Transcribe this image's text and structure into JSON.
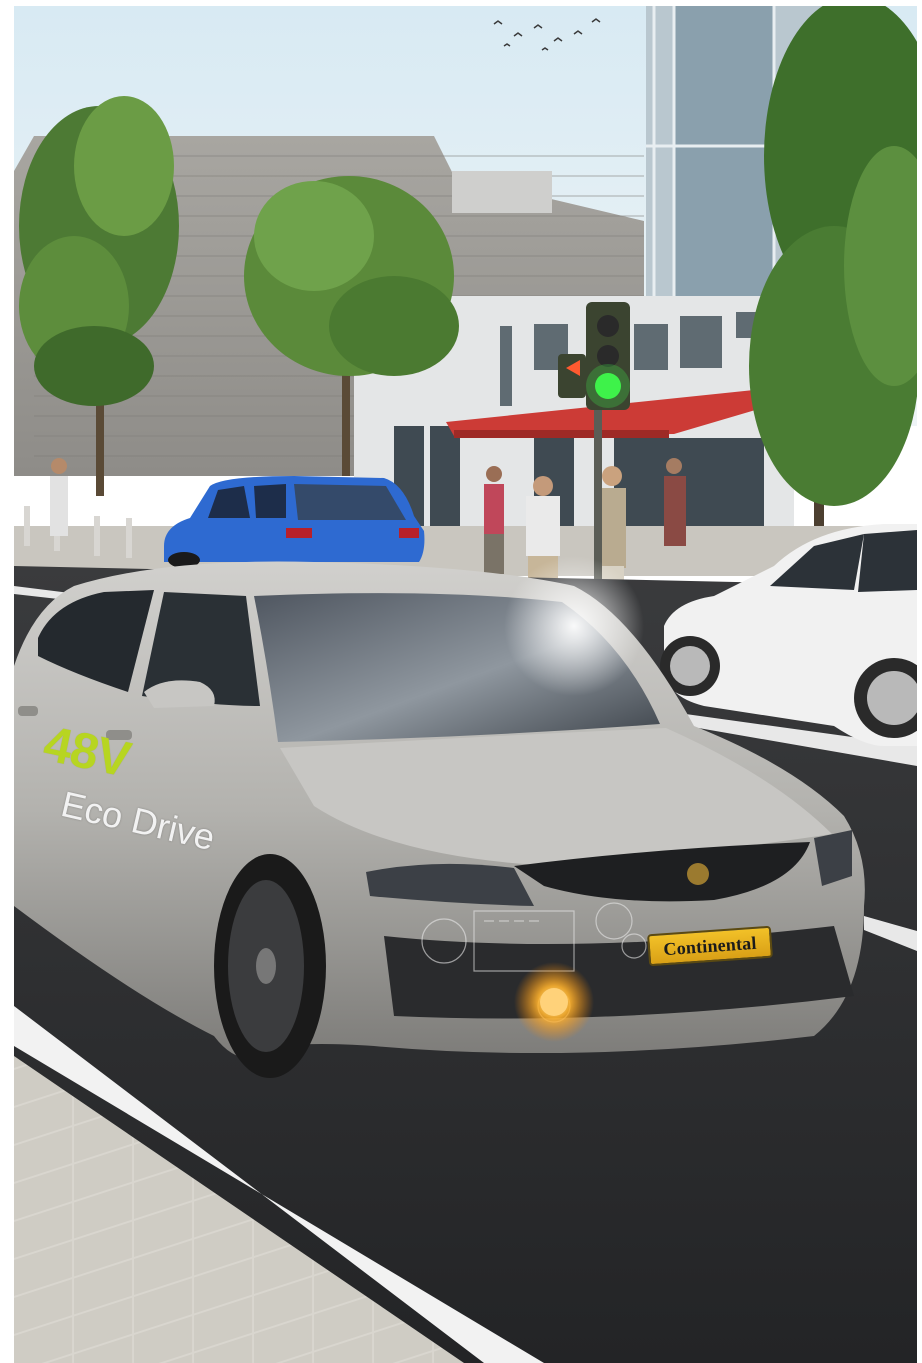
{
  "scene": {
    "decal": {
      "voltage": "48V",
      "line": "Eco Drive"
    },
    "plate": {
      "brand": "Continental"
    },
    "colors": {
      "sky": "#d9e9f2",
      "building_gray": "#9a9a9a",
      "car_silver": "#b5b4b1",
      "car_blue": "#2e6ad1",
      "car_white": "#f1f1f1",
      "road": "#2c2d2f",
      "decal_green": "#b7d521",
      "plate_yellow": "#f2c128",
      "traffic_green": "#3ef24a",
      "awning_red": "#cc3b36"
    }
  }
}
